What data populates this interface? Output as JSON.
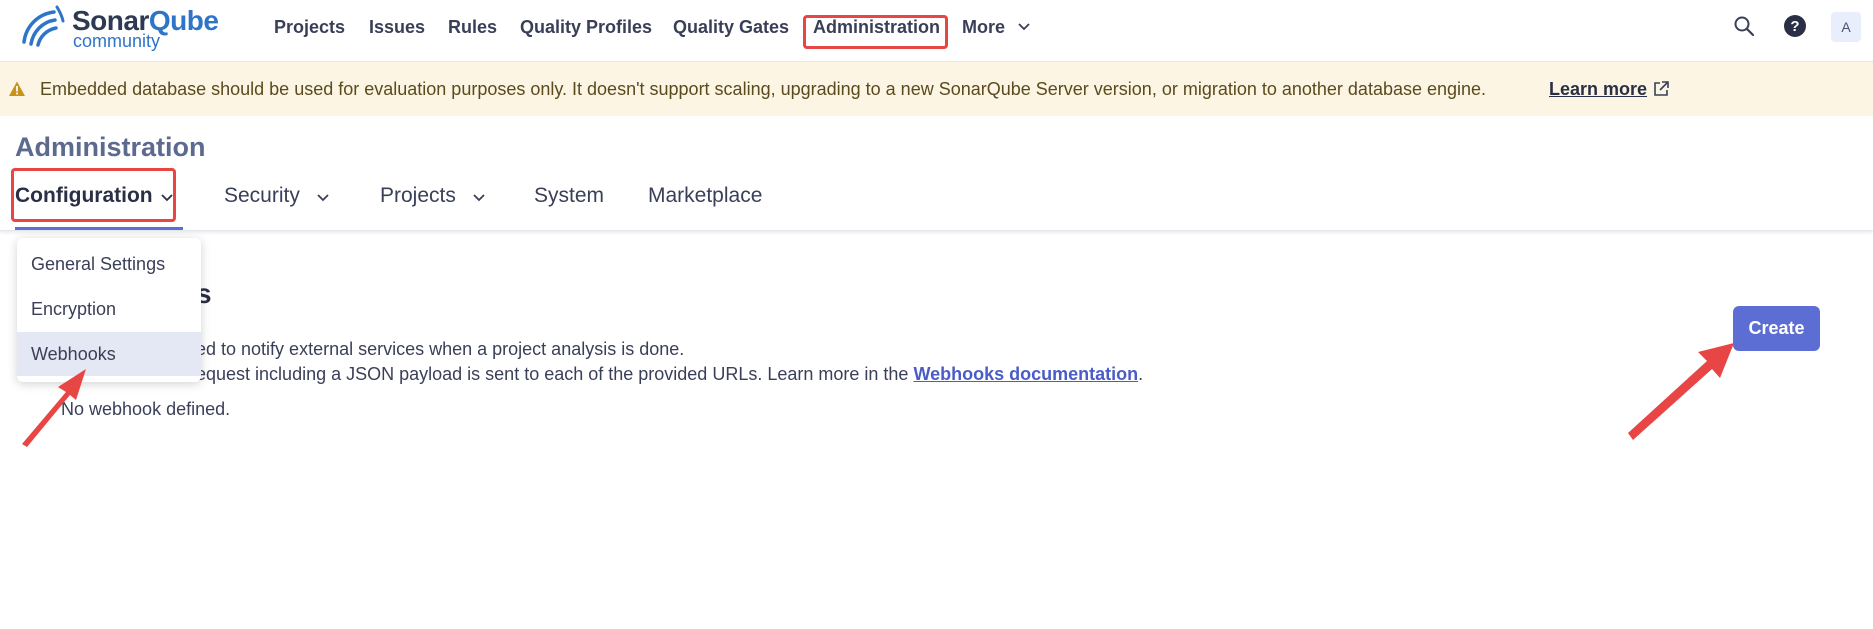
{
  "brand": {
    "name_part1": "Sonar",
    "name_part2": "Qube",
    "edition": "community"
  },
  "topnav": {
    "items": [
      "Projects",
      "Issues",
      "Rules",
      "Quality Profiles",
      "Quality Gates",
      "Administration"
    ],
    "more_label": "More",
    "avatar_initial": "A"
  },
  "banner": {
    "text": "Embedded database should be used for evaluation purposes only. It doesn't support scaling, upgrading to a new SonarQube Server version, or migration to another database engine.",
    "link_label": "Learn more"
  },
  "admin": {
    "title": "Administration",
    "tabs": [
      "Configuration",
      "Security",
      "Projects",
      "System",
      "Marketplace"
    ],
    "dropdown_items": [
      "General Settings",
      "Encryption",
      "Webhooks"
    ],
    "selected_dropdown_item": "Webhooks"
  },
  "webhooks": {
    "title_visible_tail": "s",
    "description_line1_visible": "ed to notify external services when a project analysis is done.",
    "description_line2_visible": "equest including a JSON payload is sent to each of the provided URLs. Learn more in the",
    "doc_link_label": "Webhooks documentation",
    "doc_link_suffix": ".",
    "empty_text": "No webhook defined.",
    "create_label": "Create"
  },
  "colors": {
    "accent": "#5c6ed3",
    "banner_bg": "#fcf5e4",
    "highlight": "#e84545",
    "warning": "#c7931a"
  }
}
